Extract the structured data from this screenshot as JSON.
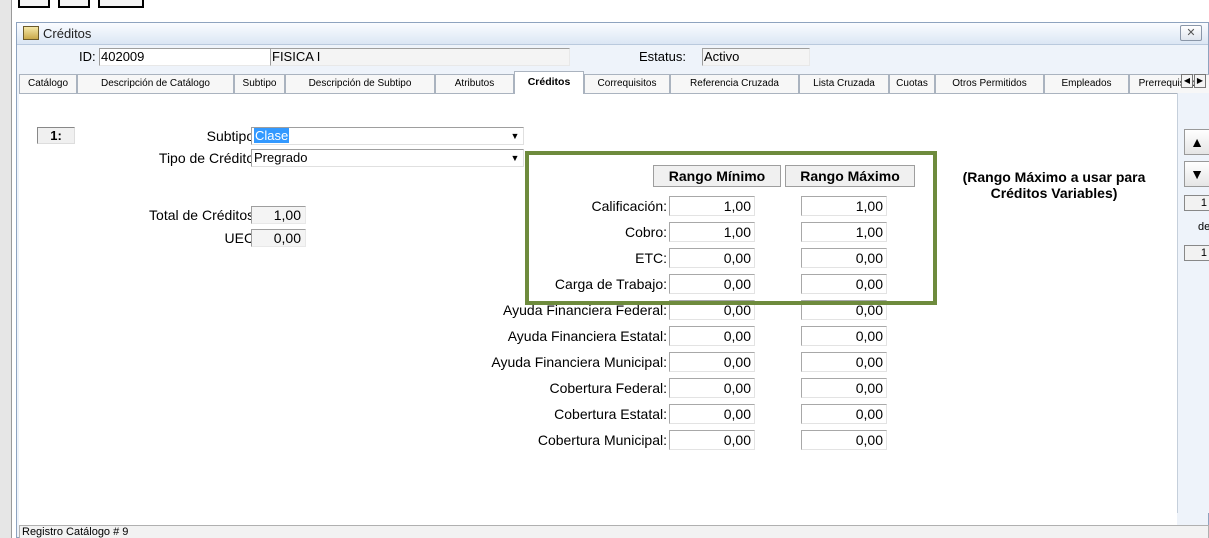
{
  "window": {
    "title": "Créditos",
    "close_label": "✕"
  },
  "header": {
    "id_label": "ID:",
    "id_value": "402009",
    "course_name": "FISICA I",
    "status_label": "Estatus:",
    "status_value": "Activo"
  },
  "tabs": [
    {
      "label": "Catálogo",
      "active": false
    },
    {
      "label": "Descripción de Catálogo",
      "active": false
    },
    {
      "label": "Subtipo",
      "active": false
    },
    {
      "label": "Descripción de Subtipo",
      "active": false
    },
    {
      "label": "Atributos",
      "active": false
    },
    {
      "label": "Créditos",
      "active": true
    },
    {
      "label": "Correquisitos",
      "active": false
    },
    {
      "label": "Referencia Cruzada",
      "active": false
    },
    {
      "label": "Lista Cruzada",
      "active": false
    },
    {
      "label": "Cuotas",
      "active": false
    },
    {
      "label": "Otros Permitidos",
      "active": false
    },
    {
      "label": "Empleados",
      "active": false
    },
    {
      "label": "Prerrequisitos",
      "active": false
    }
  ],
  "form": {
    "row_number": "1:",
    "subtipo_label": "Subtipo:",
    "subtipo_value": "Clase",
    "tipo_credito_label": "Tipo de Crédito:",
    "tipo_credito_value": "Pregrado",
    "total_creditos_label": "Total de Créditos:",
    "total_creditos_value": "1,00",
    "uec_label": "UEC:",
    "uec_value": "0,00"
  },
  "ranges": {
    "min_header": "Rango Mínimo",
    "max_header": "Rango Máximo",
    "note": "(Rango Máximo a usar para Créditos Variables)",
    "rows": [
      {
        "label": "Calificación:",
        "min": "1,00",
        "max": "1,00"
      },
      {
        "label": "Cobro:",
        "min": "1,00",
        "max": "1,00"
      },
      {
        "label": "ETC:",
        "min": "0,00",
        "max": "0,00"
      },
      {
        "label": "Carga de Trabajo:",
        "min": "0,00",
        "max": "0,00"
      },
      {
        "label": "Ayuda Financiera Federal:",
        "min": "0,00",
        "max": "0,00"
      },
      {
        "label": "Ayuda Financiera Estatal:",
        "min": "0,00",
        "max": "0,00"
      },
      {
        "label": "Ayuda Financiera Municipal:",
        "min": "0,00",
        "max": "0,00"
      },
      {
        "label": "Cobertura Federal:",
        "min": "0,00",
        "max": "0,00"
      },
      {
        "label": "Cobertura Estatal:",
        "min": "0,00",
        "max": "0,00"
      },
      {
        "label": "Cobertura Municipal:",
        "min": "0,00",
        "max": "0,00"
      }
    ]
  },
  "side": {
    "record": "1",
    "of_label": "de",
    "total": "1"
  },
  "status_bar": "Registro Catálogo # 9",
  "colors": {
    "highlight": "#6e8b3d",
    "selection": "#3399ff"
  }
}
